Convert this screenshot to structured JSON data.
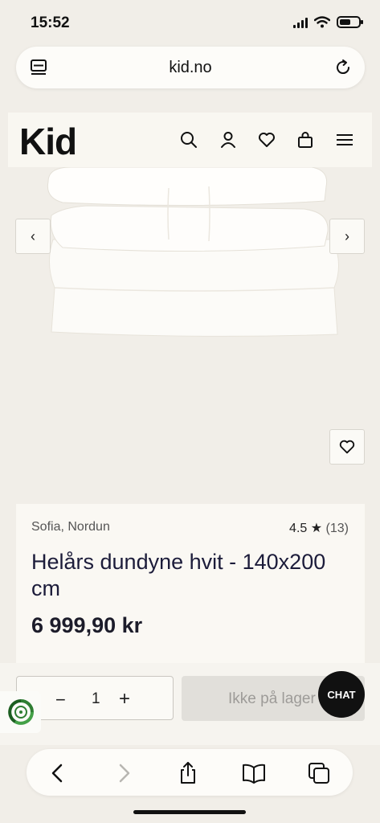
{
  "status_bar": {
    "time": "15:52"
  },
  "browser": {
    "url": "kid.no"
  },
  "header": {
    "logo": "Kid"
  },
  "product": {
    "brand": "Sofia, Nordun",
    "rating": "4.5",
    "rating_star": "★",
    "rating_count": "(13)",
    "title": "Helårs dundyne hvit - 140x200 cm",
    "price": "6 999,90 kr"
  },
  "cart": {
    "quantity_minus": "−",
    "quantity": "1",
    "quantity_plus": "+",
    "stock_label": "Ikke på lager",
    "chat_label": "CHAT"
  },
  "carousel": {
    "prev": "‹",
    "next": "›"
  },
  "colors": {
    "page_background": "#f1eee8",
    "card_background": "#faf8f3",
    "accent": "#111111"
  }
}
